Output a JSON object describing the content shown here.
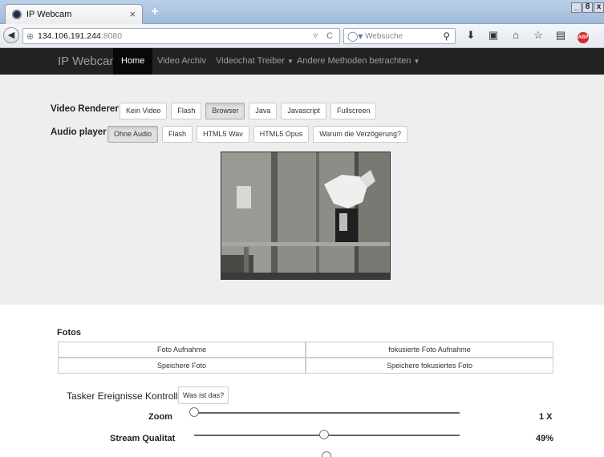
{
  "browser": {
    "tab_title": "IP Webcam",
    "tab_close": "×",
    "new_tab": "+",
    "url_host": "134.106.191.244",
    "url_port": ":8080",
    "search_placeholder": "Websuche",
    "window_controls": [
      "_",
      "8",
      "x"
    ]
  },
  "nav": {
    "brand": "IP Webcam",
    "items": [
      {
        "label": "Home"
      },
      {
        "label": "Video Archiv"
      },
      {
        "label": "Videochat Treiber"
      },
      {
        "label": "Andere Methoden betrachten"
      }
    ]
  },
  "video_renderer": {
    "label": "Video Renderer",
    "options": [
      "Kein Video",
      "Flash",
      "Browser",
      "Java",
      "Javascript",
      "Fullscreen"
    ],
    "selected": "Browser"
  },
  "audio_player": {
    "label": "Audio player",
    "options": [
      "Ohne Audio",
      "Flash",
      "HTML5 Wav",
      "HTML5 Opus",
      "Warum die Verzögerung?"
    ],
    "selected": "Ohne Audio"
  },
  "photos": {
    "title": "Fotos",
    "buttons": [
      "Foto Aufnahme",
      "fokusierte Foto Aufnahme",
      "Speichere Foto",
      "Speichere fokusiertes Foto"
    ]
  },
  "tasker": {
    "label": "Tasker Ereignisse Kontrolle",
    "help_button": "Was ist das?"
  },
  "sliders": [
    {
      "label": "Zoom",
      "value_text": "1 X",
      "fraction": 0.0
    },
    {
      "label": "Stream Qualitat",
      "value_text": "49%",
      "fraction": 0.49
    }
  ],
  "colors": {
    "navbar_bg": "#222222",
    "active_nav_bg": "#080808",
    "jumbotron_bg": "#eeeeee"
  }
}
